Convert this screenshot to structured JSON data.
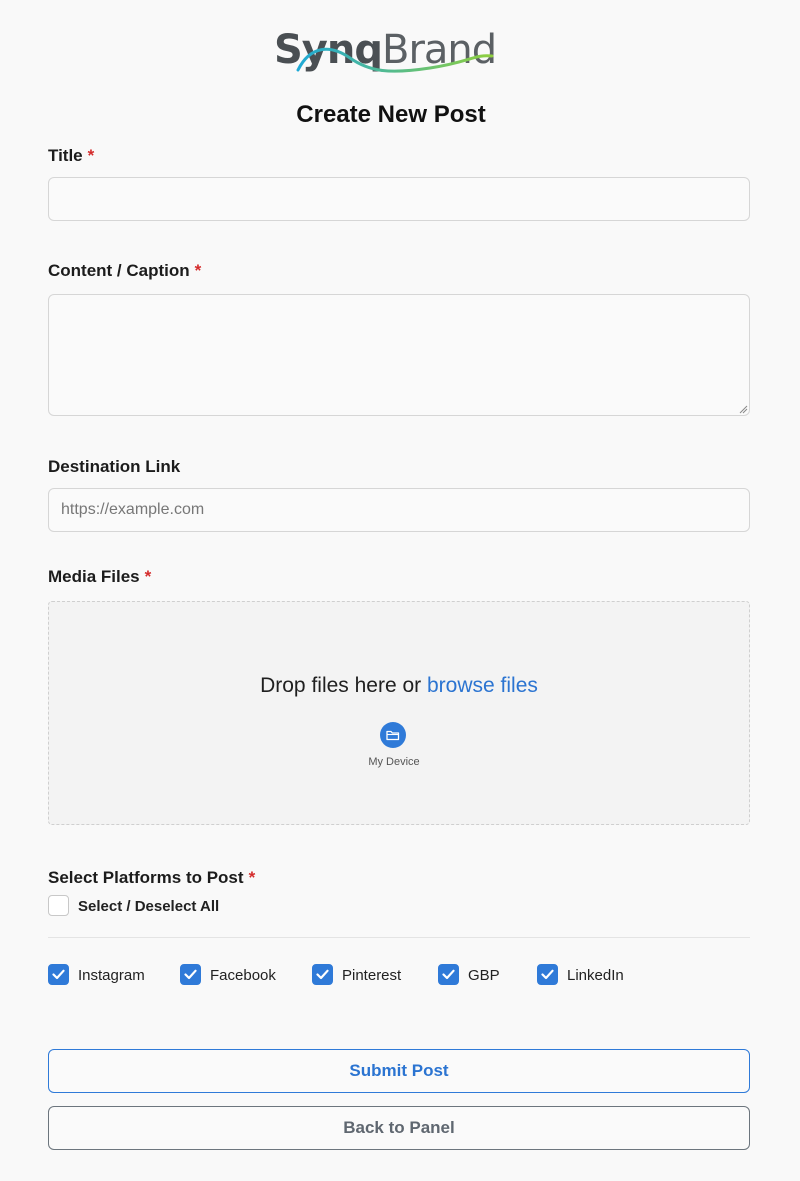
{
  "brand": {
    "part1": "Synq",
    "part2": "Brand",
    "icon": "synqbrand-logo-swoosh",
    "swoosh_colors": [
      "#1fa9d6",
      "#8fcf3f"
    ]
  },
  "page_title": "Create New Post",
  "required_marker": "*",
  "fields": {
    "title": {
      "label": "Title",
      "value": ""
    },
    "content": {
      "label": "Content / Caption",
      "value": ""
    },
    "link": {
      "label": "Destination Link",
      "value": "",
      "placeholder": "https://example.com"
    }
  },
  "media": {
    "label": "Media Files",
    "drop_text": "Drop files here or ",
    "browse_text": "browse files",
    "device_label": "My Device",
    "device_icon": "folder-icon"
  },
  "platforms": {
    "label": "Select Platforms to Post",
    "select_all_label": "Select / Deselect All",
    "select_all_checked": false,
    "items": [
      {
        "label": "Instagram",
        "checked": true
      },
      {
        "label": "Facebook",
        "checked": true
      },
      {
        "label": "Pinterest",
        "checked": true
      },
      {
        "label": "GBP",
        "checked": true
      },
      {
        "label": "LinkedIn",
        "checked": true
      }
    ]
  },
  "buttons": {
    "submit": "Submit Post",
    "back": "Back to Panel"
  },
  "colors": {
    "accent": "#2f7ad8",
    "required": "#d42a2a",
    "secondary": "#6c757d"
  }
}
